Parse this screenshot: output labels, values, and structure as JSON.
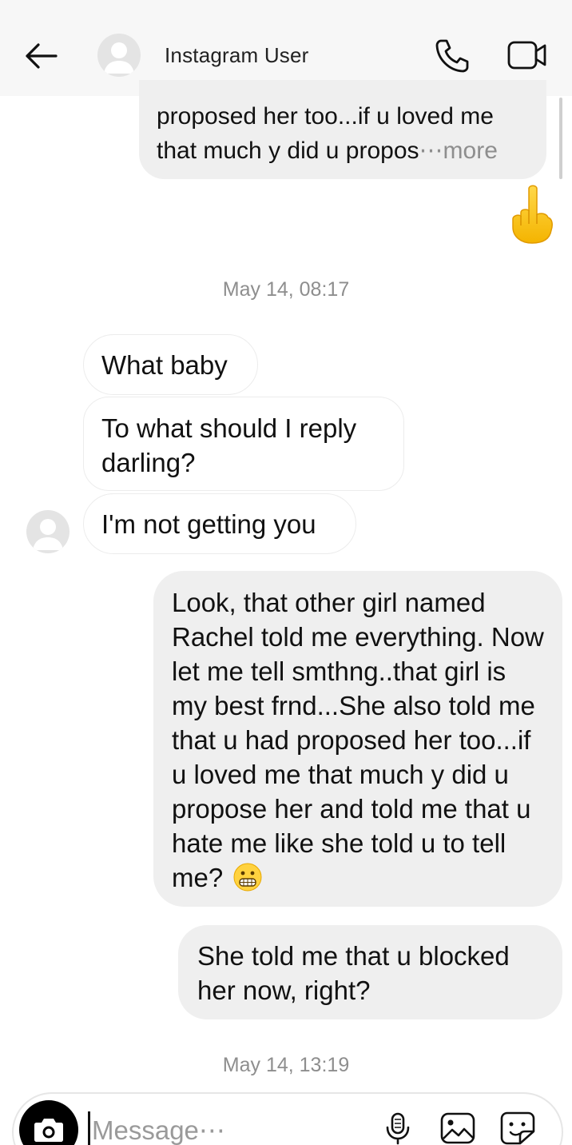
{
  "header": {
    "title": "Instagram User",
    "back_icon": "arrow-left-icon",
    "call_icon": "phone-icon",
    "video_icon": "video-camera-icon"
  },
  "thread": {
    "top_message": {
      "line1": "proposed her too...if u loved me",
      "line2": "that much y did u propos",
      "more": "⋯more"
    },
    "reaction": "☝",
    "timestamp1": "May 14, 08:17",
    "received": [
      "What baby",
      "To what should I reply darling?",
      "I'm not getting you"
    ],
    "sent_long": "Look, that other girl named Rachel told me everything. Now let me tell smthng..that girl is my best frnd...She also told me that u had proposed her too...if u loved me that much y did u propose her and told me that u hate me like she told u to tell me?",
    "sent_short": "She told me that u blocked her now, right?",
    "timestamp2": "May 14, 13:19"
  },
  "composer": {
    "placeholder": "Message⋯",
    "value": ""
  },
  "colors": {
    "sent_bubble": "#efefef",
    "received_border": "#ececec",
    "timestamp": "#8e8e8e",
    "header_bg": "#f7f7f7"
  }
}
